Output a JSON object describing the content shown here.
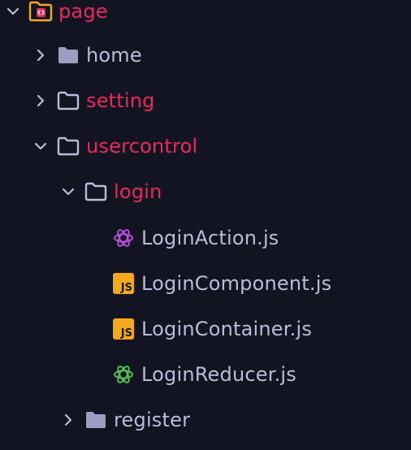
{
  "explorer": {
    "root": {
      "label": "page",
      "expanded": true,
      "color": "#e8295d"
    },
    "items": [
      {
        "label": "home",
        "type": "folder",
        "expanded": false
      },
      {
        "label": "setting",
        "type": "folder",
        "expanded": false
      },
      {
        "label": "usercontrol",
        "type": "folder",
        "expanded": true
      },
      {
        "label": "login",
        "type": "folder",
        "expanded": true
      },
      {
        "label": "LoginAction.js",
        "type": "file",
        "icon": "redux-icon"
      },
      {
        "label": "LoginComponent.js",
        "type": "file",
        "icon": "js-icon"
      },
      {
        "label": "LoginContainer.js",
        "type": "file",
        "icon": "js-icon"
      },
      {
        "label": "LoginReducer.js",
        "type": "file",
        "icon": "redux-icon"
      },
      {
        "label": "register",
        "type": "folder",
        "expanded": false
      }
    ],
    "js_badge_text": "JS"
  },
  "colors": {
    "background": "#121421",
    "open_folder_text": "#e8295d",
    "default_text": "#b9bdd8",
    "js_badge": "#f2a91f",
    "redux_purple": "#b04fd6",
    "redux_green": "#4fc04f"
  }
}
